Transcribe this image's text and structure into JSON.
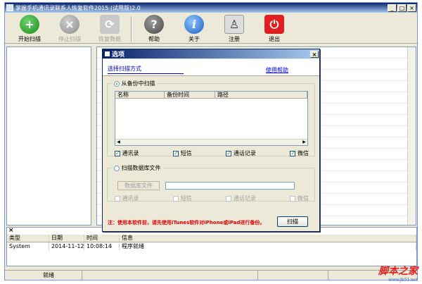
{
  "window": {
    "title": "掌握手机通讯录联系人恢复软件2015 (试用版)2.0",
    "controls": [
      "_",
      "□",
      "×"
    ]
  },
  "toolbar": {
    "buttons": [
      {
        "label": "开始扫描",
        "icon": "plus-icon",
        "glyph": "+"
      },
      {
        "label": "停止扫描",
        "icon": "stop-icon",
        "glyph": "×"
      },
      {
        "label": "恢复数据",
        "icon": "refresh-icon",
        "glyph": "⟳"
      },
      {
        "label": "帮助",
        "icon": "question-icon",
        "glyph": "?"
      },
      {
        "label": "关于",
        "icon": "info-icon",
        "glyph": "i"
      },
      {
        "label": "注册",
        "icon": "user-icon",
        "glyph": "♙"
      },
      {
        "label": "退出",
        "icon": "power-icon",
        "glyph": "⏻"
      }
    ]
  },
  "dialog": {
    "title": "选项",
    "close": "×",
    "subtitle": "选择扫描方式",
    "help_link": "使用帮助",
    "backup_option": "从备份中扫描",
    "columns": [
      "名称",
      "备份时间",
      "路径"
    ],
    "backup_checks": [
      "通讯录",
      "短信",
      "通话记录",
      "微信"
    ],
    "db_option": "扫描数据库文件",
    "db_button": "数据库文件",
    "db_checks": [
      "通讯录",
      "短信",
      "通话记录",
      "微信"
    ],
    "note": "注：使用本软件前，请先使用iTunes软件对iPhone或iPad进行备份。",
    "scan_button": "扫描",
    "scroll_left": "◀",
    "scroll_right": "▶"
  },
  "log": {
    "close": "×",
    "columns": [
      "类型",
      "日期",
      "时间",
      "信息"
    ],
    "rows": [
      [
        "System",
        "2014-11-12",
        "10:08:14",
        "程序就绪"
      ]
    ]
  },
  "status": {
    "text": "就绪"
  },
  "watermark": {
    "big": "脚本之家",
    "small": "www.jb51.net"
  }
}
